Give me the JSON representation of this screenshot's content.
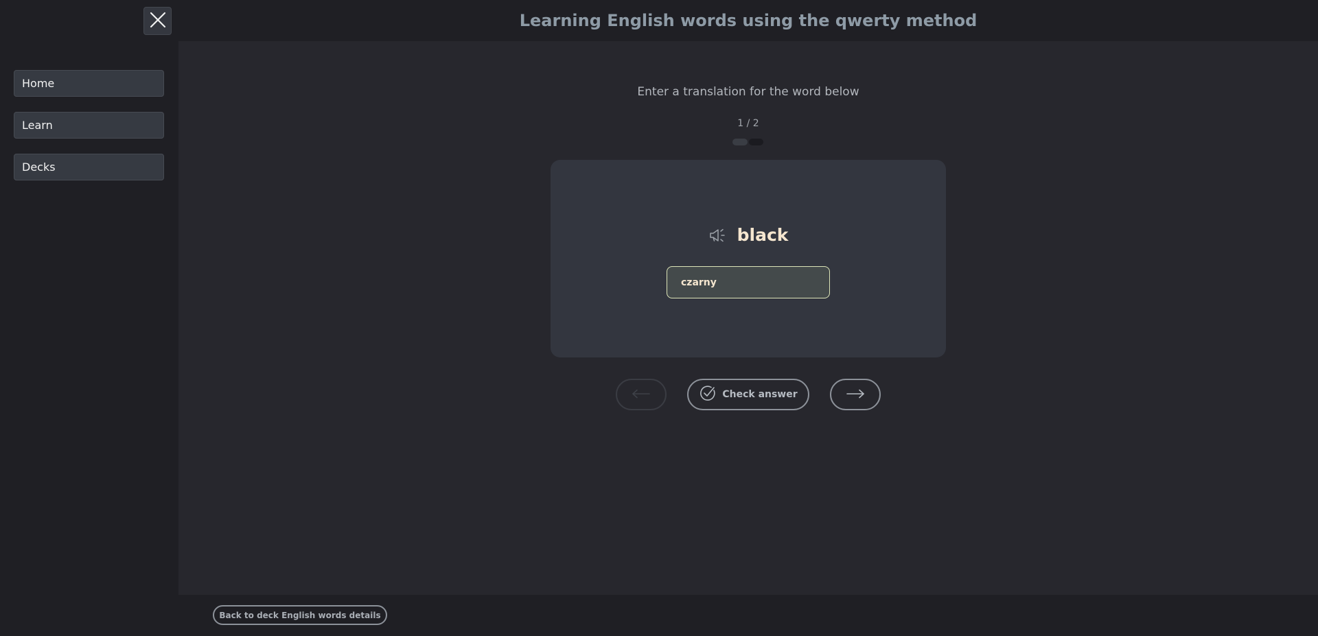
{
  "app": {
    "title": "Learning English words using the qwerty method"
  },
  "sidebar": {
    "close_icon": "close-icon",
    "items": [
      {
        "label": "Home"
      },
      {
        "label": "Learn"
      },
      {
        "label": "Decks"
      }
    ]
  },
  "main": {
    "instruction": "Enter a translation for the word below",
    "counter": "1 / 2",
    "progress": {
      "current": 1,
      "total": 2
    },
    "card": {
      "speaker_icon": "speaker-icon",
      "word": "black",
      "answer_value": "czarny"
    },
    "controls": {
      "prev_icon": "arrow-left-icon",
      "check_icon": "check-circle-icon",
      "check_label": "Check answer",
      "next_icon": "arrow-right-icon"
    }
  },
  "footer": {
    "back_label": "Back to deck English words details"
  },
  "colors": {
    "background": "#27272d",
    "sidebar": "#1f1f24",
    "card": "#33363f",
    "accent_word": "#f5e6cf",
    "input_border": "#dde5b8",
    "title": "#8e9ba6"
  }
}
